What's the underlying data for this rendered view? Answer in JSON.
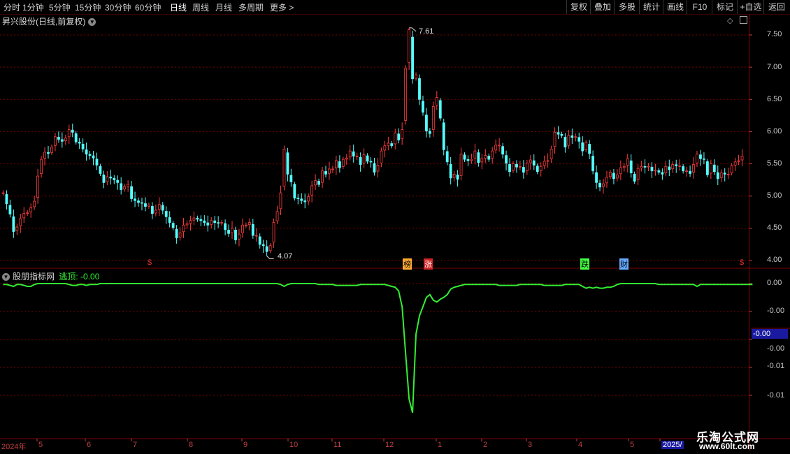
{
  "toolbar": {
    "periods": [
      "分时",
      "1分钟",
      "5分钟",
      "15分钟",
      "30分钟",
      "60分钟",
      "日线",
      "周线",
      "月线",
      "多周期",
      "更多 >"
    ],
    "active_period": "日线",
    "tools": [
      "复权",
      "叠加",
      "多股",
      "统计",
      "画线",
      "F10",
      "标记",
      "+自选",
      "返回"
    ]
  },
  "chart": {
    "title": "昇兴股份(日线,前复权)",
    "max_label": "7.61",
    "min_label": "4.07",
    "price_ticks": [
      "7.50",
      "7.00",
      "6.50",
      "6.00",
      "5.50",
      "5.00",
      "4.50",
      "4.00"
    ],
    "events": [
      {
        "text": "$",
        "color": "#e03030"
      },
      {
        "text": "榜",
        "color": "#ffaa33"
      },
      {
        "text": "涨",
        "color": "#ff4040"
      },
      {
        "text": "跌",
        "color": "#44ff44"
      },
      {
        "text": "财",
        "color": "#66aaff"
      },
      {
        "text": "$",
        "color": "#e03030"
      }
    ]
  },
  "indicator": {
    "name": "股朋指标网",
    "series_label": "逃顶: -0.00",
    "ticks": [
      "0.00",
      "-0.00",
      "-0.00",
      "-0.01",
      "-0.01"
    ],
    "current_value": "-0.00"
  },
  "xaxis": {
    "labels": [
      "2024年",
      "5",
      "6",
      "7",
      "8",
      "9",
      "10",
      "11",
      "12",
      "1",
      "2",
      "3",
      "4",
      "5",
      "2025/"
    ]
  },
  "watermark": {
    "title": "乐淘公式网",
    "url": "www.60lt.com"
  },
  "colors": {
    "up": "#ff3c3c",
    "down": "#54ffff",
    "indicator": "#33ee33",
    "grid": "#7a0000"
  },
  "chart_data": {
    "type": "candlestick",
    "ylim": [
      4.0,
      7.7
    ],
    "indicator_ylim": [
      -0.015,
      0.002
    ],
    "close": [
      5.05,
      4.88,
      4.72,
      4.45,
      4.52,
      4.65,
      4.73,
      4.74,
      4.82,
      4.92,
      5.31,
      5.57,
      5.68,
      5.66,
      5.76,
      5.92,
      5.88,
      5.85,
      5.9,
      6.03,
      5.99,
      5.84,
      5.82,
      5.73,
      5.65,
      5.63,
      5.59,
      5.48,
      5.35,
      5.21,
      5.3,
      5.28,
      5.25,
      5.21,
      5.1,
      5.15,
      5.18,
      4.96,
      4.93,
      4.9,
      4.89,
      4.84,
      4.86,
      4.73,
      4.78,
      4.87,
      4.78,
      4.68,
      4.59,
      4.51,
      4.35,
      4.43,
      4.55,
      4.57,
      4.62,
      4.66,
      4.64,
      4.62,
      4.59,
      4.55,
      4.62,
      4.59,
      4.58,
      4.59,
      4.48,
      4.42,
      4.5,
      4.32,
      4.41,
      4.55,
      4.55,
      4.59,
      4.39,
      4.39,
      4.25,
      4.23,
      4.14,
      4.23,
      4.59,
      4.76,
      5.05,
      5.73,
      5.34,
      5.22,
      4.97,
      4.96,
      4.93,
      4.91,
      4.99,
      5.16,
      5.24,
      5.18,
      5.39,
      5.34,
      5.42,
      5.42,
      5.55,
      5.44,
      5.57,
      5.59,
      5.7,
      5.62,
      5.62,
      5.49,
      5.64,
      5.54,
      5.53,
      5.37,
      5.48,
      5.7,
      5.78,
      5.82,
      5.78,
      5.98,
      5.87,
      6.03,
      6.98,
      7.58,
      6.82,
      6.88,
      6.5,
      6.3,
      6.01,
      5.97,
      6.39,
      6.53,
      6.21,
      5.72,
      5.53,
      5.28,
      5.34,
      5.26,
      5.65,
      5.57,
      5.55,
      5.57,
      5.7,
      5.52,
      5.58,
      5.63,
      5.57,
      5.7,
      5.79,
      5.79,
      5.65,
      5.51,
      5.38,
      5.5,
      5.45,
      5.46,
      5.37,
      5.51,
      5.56,
      5.48,
      5.38,
      5.46,
      5.54,
      5.55,
      5.73,
      5.99,
      5.96,
      5.94,
      5.76,
      5.94,
      5.91,
      5.92,
      5.85,
      5.7,
      5.83,
      5.66,
      5.39,
      5.21,
      5.14,
      5.19,
      5.29,
      5.37,
      5.27,
      5.33,
      5.44,
      5.46,
      5.58,
      5.36,
      5.23,
      5.43,
      5.46,
      5.45,
      5.46,
      5.39,
      5.4,
      5.37,
      5.34,
      5.46,
      5.41,
      5.49,
      5.47,
      5.47,
      5.39,
      5.39,
      5.35,
      5.49,
      5.65,
      5.58,
      5.57,
      5.33,
      5.5,
      5.38,
      5.27,
      5.36,
      5.34,
      5.34,
      5.47,
      5.53,
      5.55,
      5.62
    ],
    "indicator": [
      -0.0001,
      -0.0001,
      -0.0002,
      -0.0003,
      -0.0001,
      -0.0001,
      -0.0002,
      -0.0003,
      -0.0003,
      -0.0001,
      0.0,
      0.0,
      0.0,
      0.0,
      0.0,
      0.0,
      0.0,
      0.0,
      0.0,
      -0.0001,
      -0.0002,
      -0.0002,
      -0.0001,
      -0.0001,
      -0.0002,
      -0.0001,
      -0.0001,
      -0.0001,
      0.0,
      0.0,
      0.0,
      0.0,
      0.0,
      0.0,
      0.0,
      0.0,
      0.0,
      0.0,
      0.0,
      0.0,
      0.0,
      0.0,
      0.0,
      0.0,
      0.0,
      0.0,
      0.0,
      0.0,
      0.0,
      0.0,
      0.0,
      0.0,
      0.0,
      0.0,
      0.0,
      0.0,
      0.0,
      0.0,
      0.0,
      0.0,
      0.0,
      0.0,
      0.0,
      0.0,
      0.0,
      0.0,
      0.0,
      0.0,
      0.0,
      0.0,
      0.0,
      0.0,
      0.0,
      0.0,
      0.0,
      0.0,
      0.0,
      0.0,
      0.0,
      0.0,
      -0.0001,
      -0.0003,
      -0.0001,
      0.0,
      0.0,
      0.0,
      0.0,
      0.0,
      0.0,
      0.0,
      0.0,
      -0.0001,
      -0.0001,
      -0.0001,
      -0.0001,
      -0.0001,
      -0.0002,
      -0.0002,
      -0.0002,
      -0.0002,
      -0.0002,
      -0.0002,
      -0.0002,
      -0.0001,
      -0.0001,
      -0.0001,
      -0.0001,
      -0.0001,
      -0.0001,
      -0.0001,
      -0.0001,
      -0.0002,
      -0.0003,
      -0.0004,
      -0.0008,
      -0.0025,
      -0.0075,
      -0.0125,
      -0.014,
      -0.0055,
      -0.0035,
      -0.0025,
      -0.0015,
      -0.0012,
      -0.0018,
      -0.002,
      -0.0017,
      -0.0015,
      -0.0012,
      -0.0006,
      -0.0004,
      -0.0003,
      -0.0002,
      -0.0001,
      -0.0001,
      -0.0001,
      -0.0001,
      -0.0001,
      -0.0001,
      -0.0001,
      -0.0001,
      -0.0001,
      -0.0001,
      -0.0002,
      -0.0002,
      -0.0002,
      -0.0002,
      -0.0002,
      -0.0002,
      -0.0001,
      -0.0001,
      -0.0001,
      -0.0001,
      -0.0001,
      -0.0001,
      -0.0001,
      -0.0002,
      -0.0002,
      -0.0002,
      -0.0002,
      -0.0002,
      -0.0002,
      -0.0001,
      -0.0001,
      -0.0001,
      -0.0001,
      -0.0001,
      -0.0003,
      -0.0005,
      -0.0004,
      -0.0005,
      -0.0004,
      -0.0005,
      -0.0005,
      -0.0004,
      -0.0004,
      -0.0003,
      -0.0001,
      0.0,
      0.0,
      0.0,
      0.0,
      0.0,
      0.0,
      0.0,
      0.0,
      0.0,
      0.0,
      0.0,
      -0.0001,
      -0.0001,
      -0.0001,
      -0.0001,
      -0.0001,
      -0.0001,
      -0.0001,
      -0.0001,
      -0.0001,
      -0.0001,
      -0.0001,
      -0.0003,
      -0.0001,
      -0.0001,
      -0.0001,
      -0.0001,
      -0.0001,
      -0.0001,
      -0.0001,
      -0.0001,
      -0.0001,
      -0.0001,
      -0.0001,
      -0.0001,
      -0.0001,
      -0.0001,
      -0.0001,
      -0.0001
    ]
  }
}
